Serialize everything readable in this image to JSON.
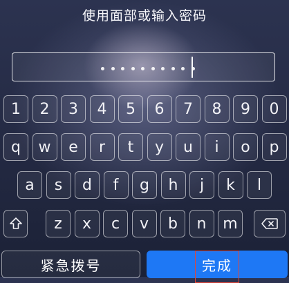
{
  "title": "使用面部或输入密码",
  "passcode": {
    "dot_count": 10,
    "cursor_visible": true
  },
  "keyboard": {
    "numbers": [
      "1",
      "2",
      "3",
      "4",
      "5",
      "6",
      "7",
      "8",
      "9",
      "0"
    ],
    "row1": [
      "q",
      "w",
      "e",
      "r",
      "t",
      "y",
      "u",
      "i",
      "o",
      "p"
    ],
    "row2": [
      "a",
      "s",
      "d",
      "f",
      "g",
      "h",
      "j",
      "k",
      "l"
    ],
    "row3": [
      "z",
      "x",
      "c",
      "v",
      "b",
      "n",
      "m"
    ],
    "shift_icon": "shift-arrow-icon",
    "delete_icon": "backspace-icon"
  },
  "buttons": {
    "emergency": "紧急拨号",
    "done": "完成"
  },
  "colors": {
    "done_button": "#1e78f5",
    "highlight_box": "#e0463a"
  }
}
